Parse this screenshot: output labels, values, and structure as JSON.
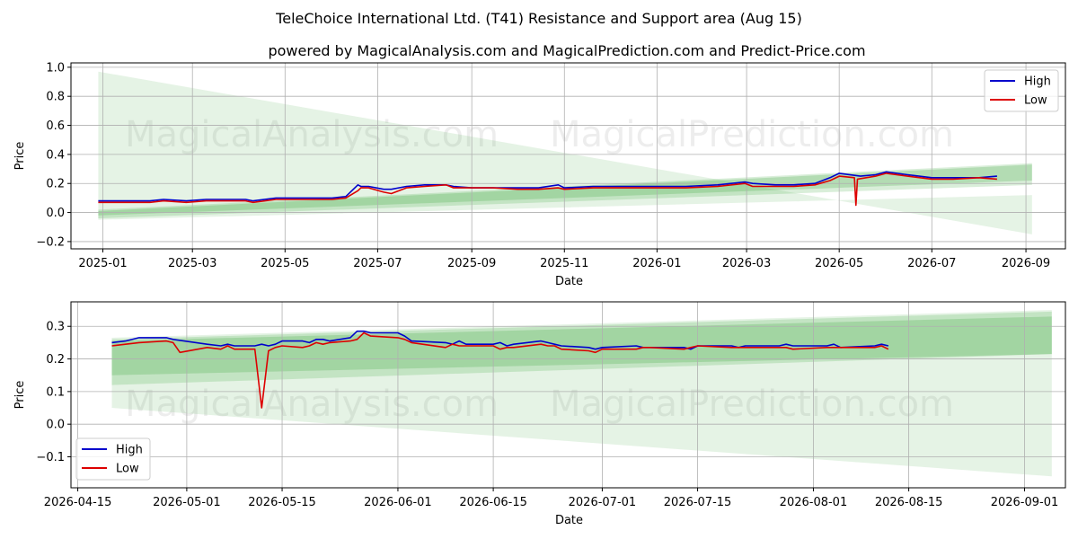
{
  "title": "TeleChoice International Ltd. (T41) Resistance and Support area (Aug 15)",
  "subtitle": "powered by MagicalAnalysis.com and MagicalPrediction.com and Predict-Price.com",
  "watermarks": [
    "MagicalAnalysis.com",
    "MagicalPrediction.com"
  ],
  "colors": {
    "high": "#0000cc",
    "low": "#dd0000",
    "band": "#2ca02c",
    "grid": "#b0b0b0"
  },
  "chart_data": [
    {
      "type": "line",
      "xlabel": "Date",
      "ylabel": "Price",
      "grid": true,
      "legend": {
        "position": "top-right",
        "entries": [
          "High",
          "Low"
        ]
      },
      "x_type": "date",
      "xlim": [
        "2024-12-11",
        "2026-09-27"
      ],
      "ylim": [
        -0.25,
        1.03
      ],
      "x_ticks": [
        "2025-01-01",
        "2025-03-01",
        "2025-05-01",
        "2025-07-01",
        "2025-09-01",
        "2025-11-01",
        "2026-01-01",
        "2026-03-01",
        "2026-05-01",
        "2026-07-01",
        "2026-09-01"
      ],
      "x_tick_labels": [
        "2025-01",
        "2025-03",
        "2025-05",
        "2025-07",
        "2025-09",
        "2025-11",
        "2026-01",
        "2026-03",
        "2026-05",
        "2026-07",
        "2026-09"
      ],
      "y_ticks": [
        -0.2,
        0.0,
        0.2,
        0.4,
        0.6,
        0.8,
        1.0
      ],
      "y_tick_labels": [
        "−0.2",
        "0.0",
        "0.2",
        "0.4",
        "0.6",
        "0.8",
        "1.0"
      ],
      "bands": [
        {
          "x": [
            "2024-12-29",
            "2026-09-05"
          ],
          "upper": [
            0.97,
            -0.15
          ],
          "lower": [
            -0.05,
            0.12
          ],
          "opacity": 0.12
        },
        {
          "x": [
            "2024-12-29",
            "2026-09-05"
          ],
          "upper": [
            0.02,
            0.34
          ],
          "lower": [
            -0.04,
            0.19
          ],
          "opacity": 0.18
        },
        {
          "x": [
            "2024-12-29",
            "2026-09-05"
          ],
          "upper": [
            0.01,
            0.33
          ],
          "lower": [
            -0.02,
            0.22
          ],
          "opacity": 0.22
        }
      ],
      "series": [
        {
          "name": "High",
          "color": "#0000cc",
          "x": [
            "2024-12-29",
            "2025-01-15",
            "2025-02-01",
            "2025-02-10",
            "2025-02-25",
            "2025-03-10",
            "2025-03-25",
            "2025-04-05",
            "2025-04-10",
            "2025-04-25",
            "2025-05-01",
            "2025-05-20",
            "2025-06-01",
            "2025-06-10",
            "2025-06-18",
            "2025-06-20",
            "2025-06-25",
            "2025-07-05",
            "2025-07-10",
            "2025-07-20",
            "2025-08-01",
            "2025-08-15",
            "2025-08-20",
            "2025-09-01",
            "2025-09-15",
            "2025-10-01",
            "2025-10-15",
            "2025-10-28",
            "2025-11-01",
            "2025-11-20",
            "2025-12-10",
            "2026-01-01",
            "2026-01-20",
            "2026-02-10",
            "2026-02-28",
            "2026-03-05",
            "2026-03-20",
            "2026-04-01",
            "2026-04-15",
            "2026-04-25",
            "2026-05-01",
            "2026-05-15",
            "2026-05-25",
            "2026-06-01",
            "2026-06-15",
            "2026-07-01",
            "2026-07-15",
            "2026-08-01",
            "2026-08-13"
          ],
          "y": [
            0.08,
            0.08,
            0.08,
            0.09,
            0.08,
            0.09,
            0.09,
            0.09,
            0.08,
            0.1,
            0.1,
            0.1,
            0.1,
            0.11,
            0.19,
            0.18,
            0.18,
            0.16,
            0.16,
            0.18,
            0.19,
            0.19,
            0.18,
            0.17,
            0.17,
            0.17,
            0.17,
            0.19,
            0.17,
            0.18,
            0.18,
            0.18,
            0.18,
            0.19,
            0.21,
            0.2,
            0.19,
            0.19,
            0.2,
            0.24,
            0.27,
            0.25,
            0.26,
            0.28,
            0.26,
            0.24,
            0.24,
            0.24,
            0.25
          ]
        },
        {
          "name": "Low",
          "color": "#dd0000",
          "x": [
            "2024-12-29",
            "2025-01-15",
            "2025-02-01",
            "2025-02-10",
            "2025-02-25",
            "2025-03-10",
            "2025-03-25",
            "2025-04-05",
            "2025-04-10",
            "2025-04-25",
            "2025-05-01",
            "2025-05-20",
            "2025-06-01",
            "2025-06-10",
            "2025-06-18",
            "2025-06-20",
            "2025-06-25",
            "2025-07-05",
            "2025-07-10",
            "2025-07-20",
            "2025-08-01",
            "2025-08-15",
            "2025-08-20",
            "2025-09-01",
            "2025-09-15",
            "2025-10-01",
            "2025-10-15",
            "2025-10-28",
            "2025-11-01",
            "2025-11-20",
            "2025-12-10",
            "2026-01-01",
            "2026-01-20",
            "2026-02-10",
            "2026-02-28",
            "2026-03-05",
            "2026-03-20",
            "2026-04-01",
            "2026-04-15",
            "2026-04-25",
            "2026-05-01",
            "2026-05-11",
            "2026-05-12",
            "2026-05-13",
            "2026-05-25",
            "2026-06-01",
            "2026-06-15",
            "2026-07-01",
            "2026-07-15",
            "2026-08-01",
            "2026-08-13"
          ],
          "y": [
            0.07,
            0.07,
            0.07,
            0.08,
            0.07,
            0.08,
            0.08,
            0.08,
            0.07,
            0.09,
            0.09,
            0.09,
            0.09,
            0.1,
            0.15,
            0.17,
            0.17,
            0.14,
            0.13,
            0.17,
            0.18,
            0.19,
            0.17,
            0.17,
            0.17,
            0.16,
            0.16,
            0.17,
            0.16,
            0.17,
            0.17,
            0.17,
            0.17,
            0.18,
            0.2,
            0.18,
            0.18,
            0.18,
            0.19,
            0.22,
            0.25,
            0.24,
            0.05,
            0.23,
            0.25,
            0.27,
            0.25,
            0.23,
            0.23,
            0.24,
            0.23
          ]
        }
      ]
    },
    {
      "type": "line",
      "xlabel": "Date",
      "ylabel": "Price",
      "grid": true,
      "legend": {
        "position": "bottom-left",
        "entries": [
          "High",
          "Low"
        ]
      },
      "x_type": "date",
      "xlim": [
        "2026-04-14",
        "2026-09-07"
      ],
      "ylim": [
        -0.195,
        0.375
      ],
      "x_ticks": [
        "2026-04-15",
        "2026-05-01",
        "2026-05-15",
        "2026-06-01",
        "2026-06-15",
        "2026-07-01",
        "2026-07-15",
        "2026-08-01",
        "2026-08-15",
        "2026-09-01"
      ],
      "x_tick_labels": [
        "2026-04-15",
        "2026-05-01",
        "2026-05-15",
        "2026-06-01",
        "2026-06-15",
        "2026-07-01",
        "2026-07-15",
        "2026-08-01",
        "2026-08-15",
        "2026-09-01"
      ],
      "y_ticks": [
        -0.1,
        0.0,
        0.1,
        0.2,
        0.3
      ],
      "y_tick_labels": [
        "−0.1",
        "0.0",
        "0.1",
        "0.2",
        "0.3"
      ],
      "bands": [
        {
          "x": [
            "2026-04-20",
            "2026-09-05"
          ],
          "upper": [
            0.265,
            0.35
          ],
          "lower": [
            0.05,
            -0.16
          ],
          "opacity": 0.12
        },
        {
          "x": [
            "2026-04-20",
            "2026-09-05"
          ],
          "upper": [
            0.26,
            0.345
          ],
          "lower": [
            0.12,
            0.215
          ],
          "opacity": 0.18
        },
        {
          "x": [
            "2026-04-20",
            "2026-09-05"
          ],
          "upper": [
            0.255,
            0.33
          ],
          "lower": [
            0.15,
            0.215
          ],
          "opacity": 0.22
        }
      ],
      "series": [
        {
          "name": "High",
          "color": "#0000cc",
          "x": [
            "2026-04-20",
            "2026-04-22",
            "2026-04-24",
            "2026-04-28",
            "2026-04-29",
            "2026-05-04",
            "2026-05-06",
            "2026-05-07",
            "2026-05-08",
            "2026-05-11",
            "2026-05-12",
            "2026-05-13",
            "2026-05-14",
            "2026-05-15",
            "2026-05-18",
            "2026-05-19",
            "2026-05-20",
            "2026-05-21",
            "2026-05-22",
            "2026-05-25",
            "2026-05-26",
            "2026-05-27",
            "2026-05-28",
            "2026-06-01",
            "2026-06-02",
            "2026-06-03",
            "2026-06-08",
            "2026-06-09",
            "2026-06-10",
            "2026-06-11",
            "2026-06-15",
            "2026-06-16",
            "2026-06-17",
            "2026-06-18",
            "2026-06-22",
            "2026-06-23",
            "2026-06-24",
            "2026-06-25",
            "2026-06-29",
            "2026-06-30",
            "2026-07-01",
            "2026-07-06",
            "2026-07-07",
            "2026-07-08",
            "2026-07-13",
            "2026-07-14",
            "2026-07-15",
            "2026-07-20",
            "2026-07-21",
            "2026-07-22",
            "2026-07-27",
            "2026-07-28",
            "2026-07-29",
            "2026-08-03",
            "2026-08-04",
            "2026-08-05",
            "2026-08-10",
            "2026-08-11",
            "2026-08-12"
          ],
          "y": [
            0.25,
            0.255,
            0.265,
            0.265,
            0.26,
            0.245,
            0.24,
            0.245,
            0.24,
            0.24,
            0.245,
            0.24,
            0.245,
            0.255,
            0.255,
            0.25,
            0.26,
            0.26,
            0.255,
            0.265,
            0.285,
            0.285,
            0.28,
            0.28,
            0.27,
            0.255,
            0.25,
            0.245,
            0.255,
            0.245,
            0.245,
            0.25,
            0.24,
            0.245,
            0.255,
            0.25,
            0.245,
            0.24,
            0.235,
            0.23,
            0.235,
            0.24,
            0.235,
            0.235,
            0.235,
            0.23,
            0.24,
            0.24,
            0.235,
            0.24,
            0.24,
            0.245,
            0.24,
            0.24,
            0.245,
            0.235,
            0.24,
            0.245,
            0.24
          ]
        },
        {
          "name": "Low",
          "color": "#dd0000",
          "x": [
            "2026-04-20",
            "2026-04-22",
            "2026-04-24",
            "2026-04-28",
            "2026-04-29",
            "2026-04-30",
            "2026-05-04",
            "2026-05-06",
            "2026-05-07",
            "2026-05-08",
            "2026-05-11",
            "2026-05-12",
            "2026-05-13",
            "2026-05-14",
            "2026-05-15",
            "2026-05-18",
            "2026-05-19",
            "2026-05-20",
            "2026-05-21",
            "2026-05-22",
            "2026-05-25",
            "2026-05-26",
            "2026-05-27",
            "2026-05-28",
            "2026-06-01",
            "2026-06-02",
            "2026-06-03",
            "2026-06-08",
            "2026-06-09",
            "2026-06-10",
            "2026-06-11",
            "2026-06-15",
            "2026-06-16",
            "2026-06-17",
            "2026-06-18",
            "2026-06-22",
            "2026-06-23",
            "2026-06-24",
            "2026-06-25",
            "2026-06-29",
            "2026-06-30",
            "2026-07-01",
            "2026-07-06",
            "2026-07-07",
            "2026-07-08",
            "2026-07-13",
            "2026-07-14",
            "2026-07-15",
            "2026-07-20",
            "2026-07-21",
            "2026-07-22",
            "2026-07-27",
            "2026-07-28",
            "2026-07-29",
            "2026-08-03",
            "2026-08-04",
            "2026-08-05",
            "2026-08-10",
            "2026-08-11",
            "2026-08-12"
          ],
          "y": [
            0.24,
            0.245,
            0.25,
            0.255,
            0.25,
            0.22,
            0.235,
            0.23,
            0.24,
            0.23,
            0.23,
            0.05,
            0.225,
            0.235,
            0.24,
            0.235,
            0.24,
            0.25,
            0.245,
            0.25,
            0.255,
            0.26,
            0.28,
            0.27,
            0.265,
            0.26,
            0.25,
            0.235,
            0.245,
            0.24,
            0.24,
            0.24,
            0.23,
            0.235,
            0.235,
            0.245,
            0.24,
            0.24,
            0.23,
            0.225,
            0.22,
            0.23,
            0.23,
            0.235,
            0.235,
            0.23,
            0.235,
            0.24,
            0.235,
            0.235,
            0.235,
            0.235,
            0.235,
            0.23,
            0.235,
            0.235,
            0.235,
            0.235,
            0.24,
            0.23
          ]
        }
      ]
    }
  ]
}
